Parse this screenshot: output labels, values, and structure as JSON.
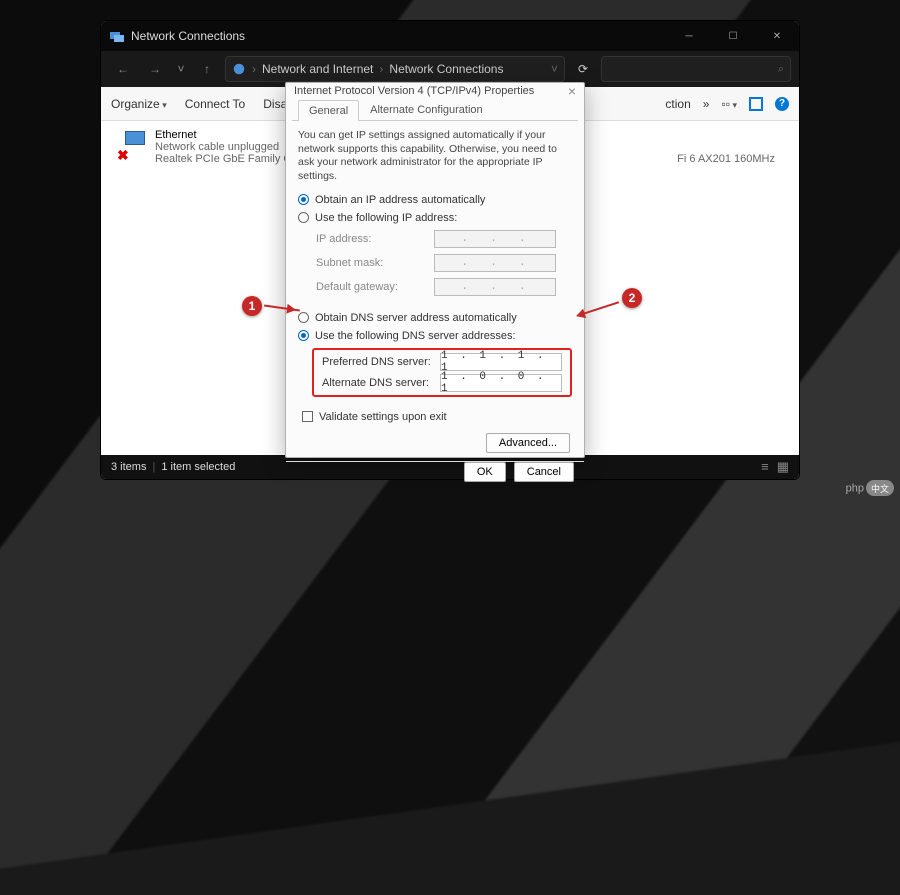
{
  "window": {
    "title": "Network Connections",
    "breadcrumb": {
      "part1": "Network and Internet",
      "part2": "Network Connections"
    }
  },
  "toolbar": {
    "organize": "Organize",
    "connect": "Connect To",
    "disable": "Disable",
    "ction": "ction",
    "raquo": "»"
  },
  "connection": {
    "name": "Ethernet",
    "status": "Network cable unplugged",
    "adapter": "Realtek PCIe GbE Family Contr"
  },
  "wifi": "Fi 6 AX201 160MHz",
  "status": {
    "items": "3 items",
    "selected": "1 item selected"
  },
  "dialog": {
    "title": "Internet Protocol Version 4 (TCP/IPv4) Properties",
    "tabs": {
      "general": "General",
      "alt": "Alternate Configuration"
    },
    "description": "You can get IP settings assigned automatically if your network supports this capability. Otherwise, you need to ask your network administrator for the appropriate IP settings.",
    "ip": {
      "auto": "Obtain an IP address automatically",
      "manual": "Use the following IP address:",
      "address": "IP address:",
      "subnet": "Subnet mask:",
      "gateway": "Default gateway:"
    },
    "dns": {
      "auto": "Obtain DNS server address automatically",
      "manual": "Use the following DNS server addresses:",
      "preferred": "Preferred DNS server:",
      "alternate": "Alternate DNS server:",
      "pref_val": "1 . 1 . 1 . 1",
      "alt_val": "1 . 0 . 0 . 1"
    },
    "validate": "Validate settings upon exit",
    "advanced": "Advanced...",
    "ok": "OK",
    "cancel": "Cancel"
  },
  "annotations": {
    "b1": "1",
    "b2": "2"
  },
  "watermark": {
    "text": "php",
    "cn": "中文"
  }
}
